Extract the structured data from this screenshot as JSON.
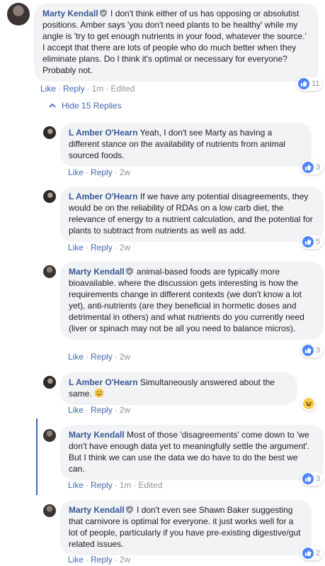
{
  "root": {
    "author": "Marty Kendall",
    "text": "I don't think either of us has opposing or absolutist positions. Amber says 'you don't need plants to be healthy' while my angle is 'try to get enough nutrients in your food, whatever the source.' I accept that there are lots of people who do much better when they eliminate plans. Do I think it's optimal or necessary for everyone? Probably not.",
    "like": "Like",
    "reply": "Reply",
    "time": "1m",
    "edited": "Edited",
    "reactions": "11"
  },
  "hide_replies": "Hide 15 Replies",
  "replies": [
    {
      "author": "L Amber O'Hearn",
      "text": "Yeah, I don't see Marty as having a different stance on the availability of nutrients from animal sourced foods.",
      "like": "Like",
      "reply": "Reply",
      "time": "2w",
      "reactions": "3"
    },
    {
      "author": "L Amber O'Hearn",
      "text": "If we have any potential disagreements, they would be on the reliability of RDAs on a low carb diet, the relevance of energy to a nutrient calculation, and the potential for plants to subtract from nutrients as well as add.",
      "like": "Like",
      "reply": "Reply",
      "time": "2w",
      "reactions": "5"
    },
    {
      "author": "Marty Kendall",
      "text": "animal-based foods are typically more bioavailable. where the discussion gets interesting is how the requirements change in different contexts (we don't know a lot yet), anti-nutrients (are they beneficial in hormetic doses and detrimental in others) and what nutrients do you currently need (liver or spinach may not be all you need to balance micros).",
      "like": "Like",
      "reply": "Reply",
      "time": "2w",
      "reactions": "3"
    },
    {
      "author": "L Amber O'Hearn",
      "text": "Simultaneously answered about the same.",
      "like": "Like",
      "reply": "Reply",
      "time": "2w",
      "reactions": ""
    },
    {
      "author": "Marty Kendall",
      "text": "Most of those 'disagreements' come down to 'we don't have enough data yet to meaningfully settle the argument'. But I think we can use the data we do have to do the best we can.",
      "like": "Like",
      "reply": "Reply",
      "time": "1m",
      "edited": "Edited",
      "reactions": "3"
    },
    {
      "author": "Marty Kendall",
      "text": "I don't even see Shawn Baker suggesting that carnivore is optimal for everyone. it just works well for a lot of people, particularly if you have pre-existing digestive/gut related issues.",
      "like": "Like",
      "reply": "Reply",
      "time": "2w",
      "reactions": "2"
    }
  ],
  "icons": {
    "verified": "shield-icon",
    "like_reaction": "like-reaction-icon",
    "haha_reaction": "haha-reaction-icon",
    "chevron_up": "chevron-up-icon",
    "smiley": "smiley-emoji-icon"
  },
  "colors": {
    "author_link": "#385898",
    "action_link": "#4267b2",
    "bubble_bg": "#f2f3f5",
    "like_blue": "#4e86f7"
  }
}
